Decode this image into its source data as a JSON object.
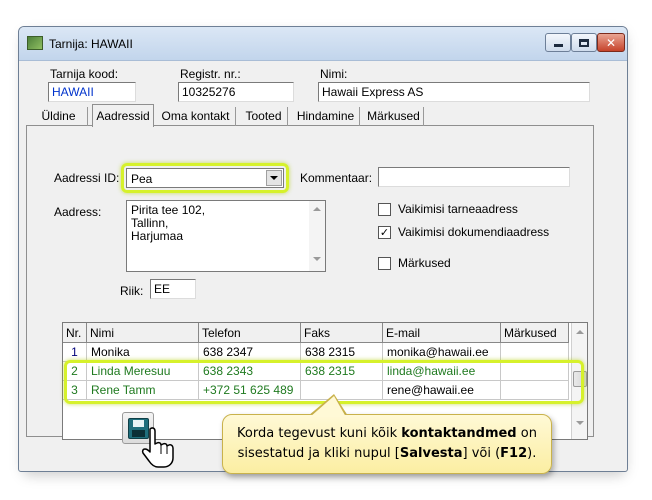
{
  "window": {
    "title": "Tarnija: HAWAII",
    "icon": "app-window-icon",
    "controls": [
      "minimize-icon",
      "maximize-icon",
      "close-icon"
    ]
  },
  "header": {
    "supplier_code_label": "Tarnija kood:",
    "supplier_code_value": "HAWAII",
    "reg_no_label": "Registr. nr.:",
    "reg_no_value": "10325276",
    "name_label": "Nimi:",
    "name_value": "Hawaii Express AS"
  },
  "tabs": [
    {
      "label": "Üldine"
    },
    {
      "label": "Aadressid"
    },
    {
      "label": "Oma kontakt"
    },
    {
      "label": "Tooted"
    },
    {
      "label": "Hindamine"
    },
    {
      "label": "Märkused"
    }
  ],
  "active_tab": "Aadressid",
  "address": {
    "id_label": "Aadressi ID:",
    "id_value": "Pea",
    "comment_label": "Kommentaar:",
    "comment_value": "",
    "address_label": "Aadress:",
    "address_lines": [
      "Pirita tee 102,",
      "Tallinn,",
      "Harjumaa"
    ],
    "country_label": "Riik:",
    "country_value": "EE"
  },
  "checkboxes": [
    {
      "label": "Vaikimisi tarneaadress",
      "checked": false,
      "mark": ""
    },
    {
      "label": "Vaikimisi dokumendiaadress",
      "checked": true,
      "mark": "✓"
    },
    {
      "label": "Märkused",
      "checked": false,
      "mark": ""
    }
  ],
  "contacts": {
    "headers": [
      "Nr.",
      "Nimi",
      "Telefon",
      "Faks",
      "E-mail",
      "Märkused"
    ],
    "rows": [
      {
        "nr": "1",
        "name": "Monika",
        "phone": "638 2347",
        "fax": "638 2315",
        "email": "monika@hawaii.ee",
        "notes": ""
      },
      {
        "nr": "2",
        "name": "Linda Meresuu",
        "phone": "638 2343",
        "fax": "638 2315",
        "email": "linda@hawaii.ee",
        "notes": ""
      },
      {
        "nr": "3",
        "name": "Rene Tamm",
        "phone": "+372 51 625 489",
        "fax": "",
        "email": "rene@hawaii.ee",
        "notes": ""
      }
    ]
  },
  "save_button": {
    "icon": "floppy-disk-icon",
    "cursor": "hand-pointer-icon"
  },
  "callout": {
    "text_1": "Korda tegevust kuni kõik ",
    "bold_1": "kontaktandmed",
    "text_2": " on",
    "text_3": "sisestatud ja kliki nupul [",
    "bold_2": "Salvesta",
    "text_4": "] või (",
    "bold_3": "F12",
    "text_5": ")."
  },
  "colors": {
    "highlight": "#d6f12b",
    "row1_text": "#00007a",
    "new_rows_text": "#1f7a1f",
    "callout_bg": "#fbeea2"
  }
}
